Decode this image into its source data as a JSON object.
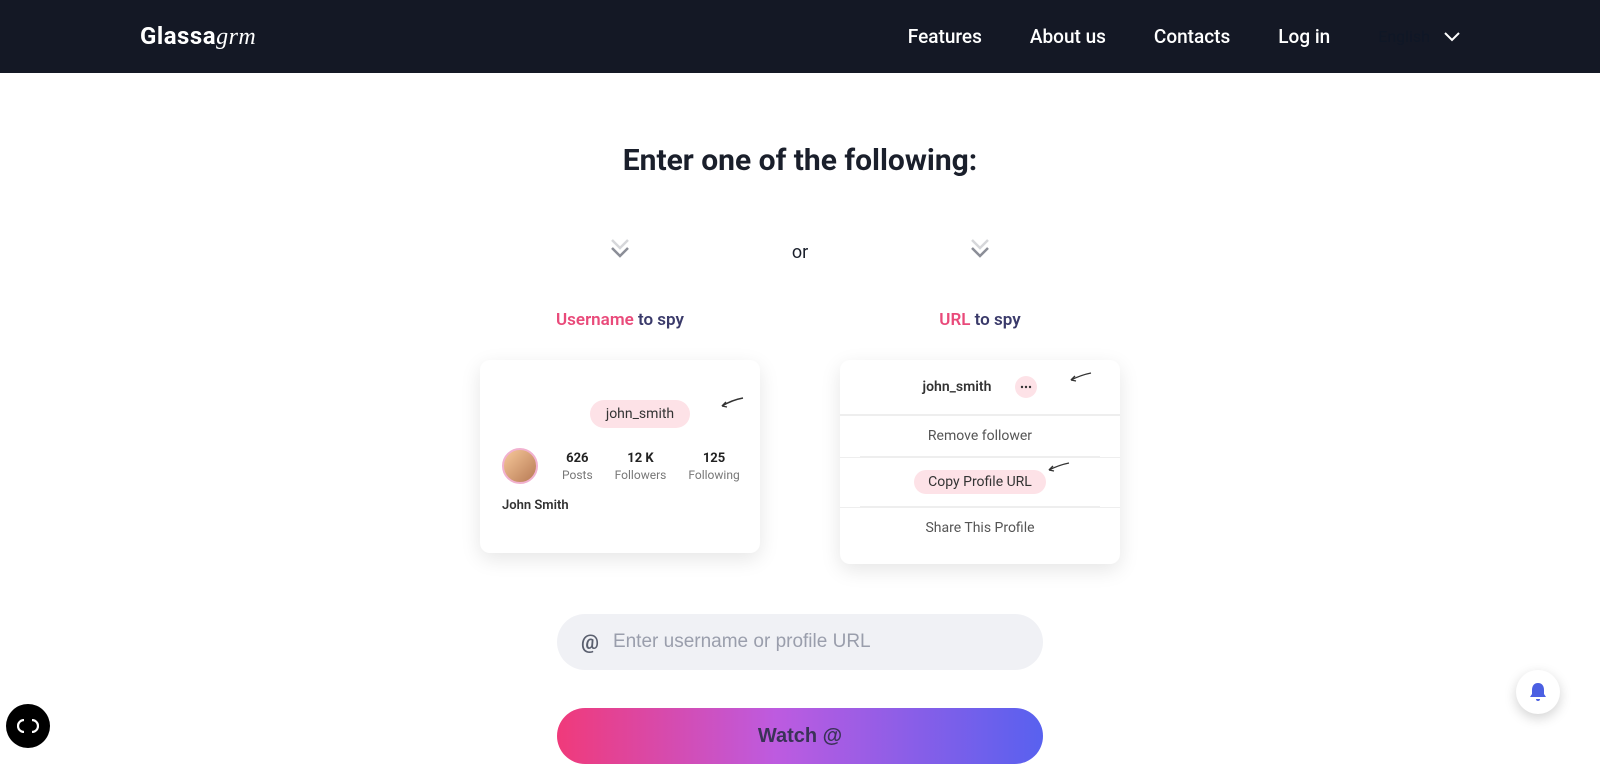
{
  "header": {
    "logo_main": "Glassa",
    "logo_serif": "grm",
    "nav": {
      "features": "Features",
      "about": "About us",
      "contacts": "Contacts",
      "login": "Log in"
    },
    "language": "English"
  },
  "main": {
    "title": "Enter one of the following:",
    "or": "or",
    "option_a_highlight": "Username",
    "option_a_rest": " to spy",
    "option_b_highlight": "URL",
    "option_b_rest": " to spy",
    "card_a": {
      "username": "john_smith",
      "stats": {
        "posts_count": "626",
        "posts_label": "Posts",
        "followers_count": "12 K",
        "followers_label": "Followers",
        "following_count": "125",
        "following_label": "Following"
      },
      "full_name": "John Smith"
    },
    "card_b": {
      "username": "john_smith",
      "menu": {
        "remove": "Remove follower",
        "copy": "Copy Profile URL",
        "share": "Share This Profile"
      }
    },
    "input_placeholder": "Enter username or profile URL",
    "input_value": "",
    "watch_button": "Watch @"
  }
}
